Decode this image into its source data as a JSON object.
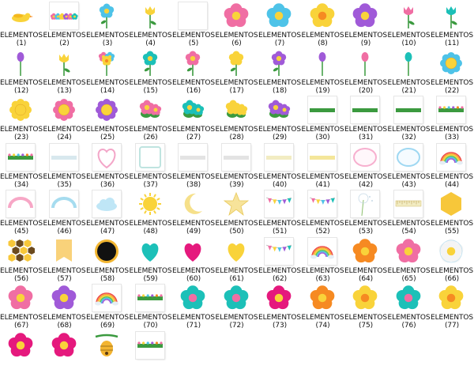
{
  "files": [
    {
      "label": "ELEMENTOS (1)",
      "icon": "yellow-bird-icon"
    },
    {
      "label": "ELEMENTOS (2)",
      "icon": "flower-garland-icon"
    },
    {
      "label": "ELEMENTOS (3)",
      "icon": "blue-tulip-icon"
    },
    {
      "label": "ELEMENTOS (4)",
      "icon": "yellow-tulip-icon"
    },
    {
      "label": "ELEMENTOS (5)",
      "icon": "blank-sheet-icon"
    },
    {
      "label": "ELEMENTOS (6)",
      "icon": "pink-flower-icon"
    },
    {
      "label": "ELEMENTOS (7)",
      "icon": "blue-flower-icon"
    },
    {
      "label": "ELEMENTOS (8)",
      "icon": "yellow-flower-icon"
    },
    {
      "label": "ELEMENTOS (9)",
      "icon": "purple-flower-icon"
    },
    {
      "label": "ELEMENTOS (10)",
      "icon": "pink-tulip-icon"
    },
    {
      "label": "ELEMENTOS (11)",
      "icon": "teal-tulip-icon"
    },
    {
      "label": "ELEMENTOS (12)",
      "icon": "purple-tulip-icon"
    },
    {
      "label": "ELEMENTOS (13)",
      "icon": "yellow-tulip-icon"
    },
    {
      "label": "ELEMENTOS (14)",
      "icon": "mixed-bouquet-icon"
    },
    {
      "label": "ELEMENTOS (15)",
      "icon": "teal-stem-flower-icon"
    },
    {
      "label": "ELEMENTOS (16)",
      "icon": "pink-stem-flower-icon"
    },
    {
      "label": "ELEMENTOS (17)",
      "icon": "yellow-stem-flower-icon"
    },
    {
      "label": "ELEMENTOS (18)",
      "icon": "purple-stem-flower-icon"
    },
    {
      "label": "ELEMENTOS (19)",
      "icon": "purple-bud-icon"
    },
    {
      "label": "ELEMENTOS (20)",
      "icon": "pink-bud-icon"
    },
    {
      "label": "ELEMENTOS (21)",
      "icon": "teal-bud-icon"
    },
    {
      "label": "ELEMENTOS (22)",
      "icon": "blue-daisy-icon"
    },
    {
      "label": "ELEMENTOS (23)",
      "icon": "yellow-daisy-icon"
    },
    {
      "label": "ELEMENTOS (24)",
      "icon": "pink-daisy-icon"
    },
    {
      "label": "ELEMENTOS (25)",
      "icon": "purple-daisy-icon"
    },
    {
      "label": "ELEMENTOS (26)",
      "icon": "pink-flower-bush-icon"
    },
    {
      "label": "ELEMENTOS (27)",
      "icon": "teal-flower-bush-icon"
    },
    {
      "label": "ELEMENTOS (28)",
      "icon": "yellow-flower-bush-icon"
    },
    {
      "label": "ELEMENTOS (29)",
      "icon": "purple-flower-bush-icon"
    },
    {
      "label": "ELEMENTOS (30)",
      "icon": "grass-strip-icon"
    },
    {
      "label": "ELEMENTOS (31)",
      "icon": "grass-strip-icon"
    },
    {
      "label": "ELEMENTOS (32)",
      "icon": "grass-strip-icon"
    },
    {
      "label": "ELEMENTOS (33)",
      "icon": "flower-grass-strip-icon"
    },
    {
      "label": "ELEMENTOS (34)",
      "icon": "flower-grass-strip-icon"
    },
    {
      "label": "ELEMENTOS (35)",
      "icon": "lace-strip-icon"
    },
    {
      "label": "ELEMENTOS (36)",
      "icon": "heart-frame-icon"
    },
    {
      "label": "ELEMENTOS (37)",
      "icon": "square-frame-icon"
    },
    {
      "label": "ELEMENTOS (38)",
      "icon": "gray-strip-icon"
    },
    {
      "label": "ELEMENTOS (39)",
      "icon": "gray-strip-icon"
    },
    {
      "label": "ELEMENTOS (40)",
      "icon": "cream-strip-icon"
    },
    {
      "label": "ELEMENTOS (41)",
      "icon": "yellow-strip-icon"
    },
    {
      "label": "ELEMENTOS (42)",
      "icon": "pink-oval-frame-icon"
    },
    {
      "label": "ELEMENTOS (43)",
      "icon": "blue-oval-frame-icon"
    },
    {
      "label": "ELEMENTOS (44)",
      "icon": "rainbow-arc-icon"
    },
    {
      "label": "ELEMENTOS (45)",
      "icon": "pink-arc-icon"
    },
    {
      "label": "ELEMENTOS (46)",
      "icon": "blue-arc-icon"
    },
    {
      "label": "ELEMENTOS (47)",
      "icon": "cloud-icon"
    },
    {
      "label": "ELEMENTOS (48)",
      "icon": "sun-icon"
    },
    {
      "label": "ELEMENTOS (49)",
      "icon": "moon-icon"
    },
    {
      "label": "ELEMENTOS (50)",
      "icon": "star-icon"
    },
    {
      "label": "ELEMENTOS (51)",
      "icon": "bunting-icon"
    },
    {
      "label": "ELEMENTOS (52)",
      "icon": "bunting-icon"
    },
    {
      "label": "ELEMENTOS (53)",
      "icon": "dandelion-icon"
    },
    {
      "label": "ELEMENTOS (54)",
      "icon": "ruler-icon"
    },
    {
      "label": "ELEMENTOS (55)",
      "icon": "yellow-hexagon-icon"
    },
    {
      "label": "ELEMENTOS (56)",
      "icon": "honeycomb-icon"
    },
    {
      "label": "ELEMENTOS (57)",
      "icon": "yellow-banner-icon"
    },
    {
      "label": "ELEMENTOS (58)",
      "icon": "black-circle-icon"
    },
    {
      "label": "ELEMENTOS (59)",
      "icon": "teal-heart-icon"
    },
    {
      "label": "ELEMENTOS (60)",
      "icon": "pink-heart-icon"
    },
    {
      "label": "ELEMENTOS (61)",
      "icon": "yellow-heart-icon"
    },
    {
      "label": "ELEMENTOS (62)",
      "icon": "bunting-icon"
    },
    {
      "label": "ELEMENTOS (63)",
      "icon": "rainbow-icon"
    },
    {
      "label": "ELEMENTOS (64)",
      "icon": "orange-flower-icon"
    },
    {
      "label": "ELEMENTOS (65)",
      "icon": "pink-flower-icon"
    },
    {
      "label": "ELEMENTOS (66)",
      "icon": "white-flower-icon"
    },
    {
      "label": "ELEMENTOS (67)",
      "icon": "pink-flower-icon"
    },
    {
      "label": "ELEMENTOS (68)",
      "icon": "purple-flower-icon"
    },
    {
      "label": "ELEMENTOS (69)",
      "icon": "rainbow-icon"
    },
    {
      "label": "ELEMENTOS (70)",
      "icon": "flower-grass-strip-icon"
    },
    {
      "label": "ELEMENTOS (71)",
      "icon": "teal-flower-icon"
    },
    {
      "label": "ELEMENTOS (72)",
      "icon": "teal-flower-icon"
    },
    {
      "label": "ELEMENTOS (73)",
      "icon": "magenta-flower-icon"
    },
    {
      "label": "ELEMENTOS (74)",
      "icon": "orange-flower-icon"
    },
    {
      "label": "ELEMENTOS (75)",
      "icon": "yellow-flower-icon"
    },
    {
      "label": "ELEMENTOS (76)",
      "icon": "teal-flower-icon"
    },
    {
      "label": "ELEMENTOS (77)",
      "icon": "yellow-flower-icon"
    },
    {
      "label": "",
      "icon": "magenta-flower-icon"
    },
    {
      "label": "",
      "icon": "magenta-flower-icon"
    },
    {
      "label": "",
      "icon": "beehive-icon"
    },
    {
      "label": "",
      "icon": "flower-grass-strip-icon"
    }
  ],
  "colors": {
    "pink": "#f06ea3",
    "blue": "#4ec3e8",
    "yellow": "#f9d33a",
    "purple": "#a05ad8",
    "teal": "#1cc0b8",
    "orange": "#f68a22",
    "magenta": "#e5197d",
    "green": "#3b9a3f",
    "white": "#ffffff",
    "gray": "#cfcfcf",
    "cream": "#f2ecc2",
    "black": "#111111"
  }
}
